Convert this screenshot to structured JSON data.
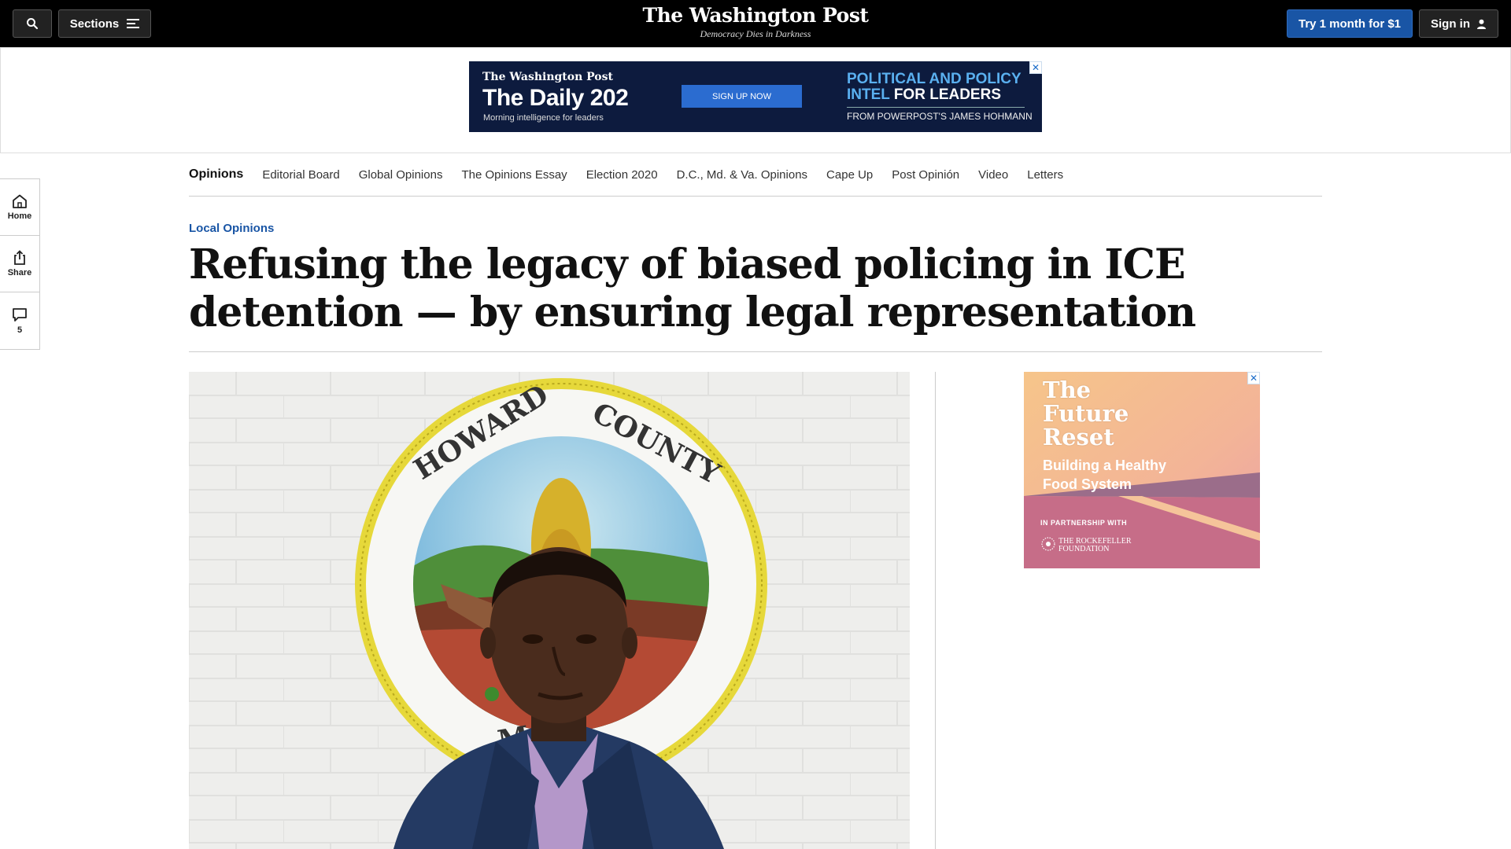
{
  "header": {
    "sections_label": "Sections",
    "logo": "The Washington Post",
    "tagline": "Democracy Dies in Darkness",
    "try_label": "Try 1 month for $1",
    "signin_label": "Sign in"
  },
  "top_ad": {
    "logo": "The Washington Post",
    "title": "The Daily 202",
    "subtitle": "Morning intelligence for leaders",
    "button": "SIGN UP NOW",
    "headline_blue": "POLITICAL AND POLICY INTEL",
    "headline_white": "FOR LEADERS",
    "from": "FROM POWERPOST'S JAMES HOHMANN",
    "close": "✕"
  },
  "subnav": {
    "items": [
      "Opinions",
      "Editorial Board",
      "Global Opinions",
      "The Opinions Essay",
      "Election 2020",
      "D.C., Md. & Va. Opinions",
      "Cape Up",
      "Post Opinión",
      "Video",
      "Letters"
    ]
  },
  "rail": {
    "home": "Home",
    "share": "Share",
    "comments_count": "5"
  },
  "article": {
    "kicker": "Local Opinions",
    "headline": "Refusing the legacy of biased policing in ICE detention — by ensuring legal representation",
    "photo_seal_top": "HOWARD      COUNTY",
    "photo_seal_bottom": "MA"
  },
  "side_ad": {
    "title": "The Future Reset",
    "subtitle": "Building a Healthy Food System",
    "partner_label": "IN PARTNERSHIP WITH",
    "partner_name": "THE ROCKEFELLER FOUNDATION",
    "close": "✕"
  },
  "colors": {
    "topbar": "#000000",
    "accent_blue": "#1955a5",
    "ad_navy": "#0d1b3e"
  }
}
